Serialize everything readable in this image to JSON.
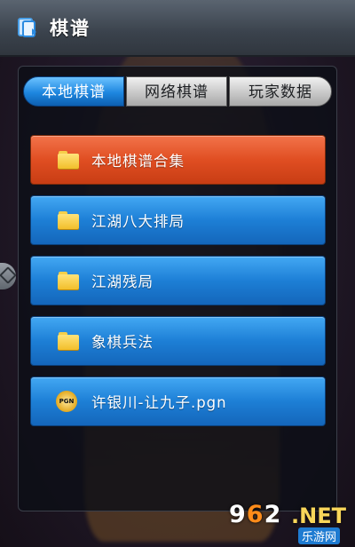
{
  "header": {
    "title": "棋谱",
    "icon": "chess-record-icon"
  },
  "tabs": [
    {
      "label": "本地棋谱",
      "active": true
    },
    {
      "label": "网络棋谱",
      "active": false
    },
    {
      "label": "玩家数据",
      "active": false
    }
  ],
  "list": [
    {
      "label": "本地棋谱合集",
      "icon": "folder-icon",
      "highlighted": true
    },
    {
      "label": "江湖八大排局",
      "icon": "folder-icon"
    },
    {
      "label": "江湖残局",
      "icon": "folder-icon"
    },
    {
      "label": "象棋兵法",
      "icon": "folder-icon"
    },
    {
      "label": "许银川-让九子.pgn",
      "icon": "pgn-file-icon",
      "pgn_badge": "PGN"
    }
  ],
  "watermark": {
    "num_a": "9",
    "num_b": "6",
    "num_c": "2",
    "net": ".NET",
    "cn": "乐游网"
  },
  "colors": {
    "active_tab": "#1d86df",
    "highlight_item": "#e04e22",
    "item": "#1d7fd6"
  }
}
